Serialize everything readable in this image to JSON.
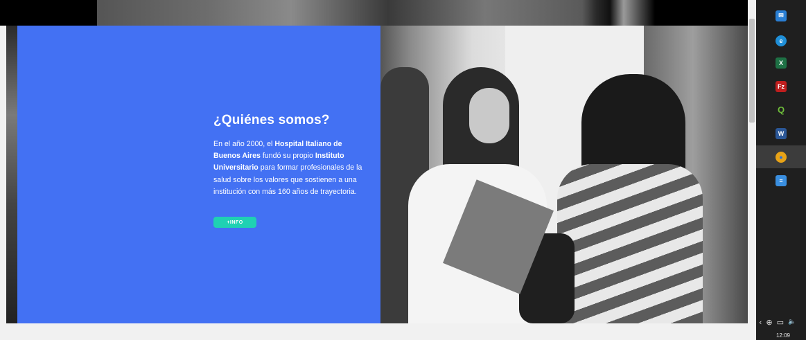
{
  "hero": {
    "title": "¿Quiénes somos?",
    "paragraph": {
      "t1": "En el año 2000, el ",
      "b1": "Hospital Italiano de Buenos Aires",
      "t2": " fundó su propio ",
      "b2": "Instituto Universitario",
      "t3": " para formar profesionales de la salud sobre los valores que sostienen a una institución con más 160 años de trayectoria."
    },
    "button_label": "+INFO",
    "panel_color": "#4371f3",
    "button_color": "#1fd1b3"
  },
  "taskbar": {
    "icons": [
      {
        "name": "mail-icon",
        "glyph": "✉",
        "color": "#2a7fd4"
      },
      {
        "name": "edge-icon",
        "glyph": "e",
        "color": "#1f8fd8"
      },
      {
        "name": "excel-icon",
        "glyph": "X",
        "color": "#1e7145"
      },
      {
        "name": "filezilla-icon",
        "glyph": "Fz",
        "color": "#bf1e1e"
      },
      {
        "name": "qgis-icon",
        "glyph": "Q",
        "color": "#4c8b2b"
      },
      {
        "name": "word-icon",
        "glyph": "W",
        "color": "#2b5797"
      },
      {
        "name": "chrome-icon",
        "glyph": "●",
        "color": "#e8a317"
      },
      {
        "name": "notepad-icon",
        "glyph": "≡",
        "color": "#3a8fe0"
      }
    ],
    "active_icon": "chrome-icon",
    "tray": {
      "chevron": "‹",
      "network": "⊕",
      "display": "▭",
      "volume": "🔈"
    },
    "clock": "12:09"
  }
}
